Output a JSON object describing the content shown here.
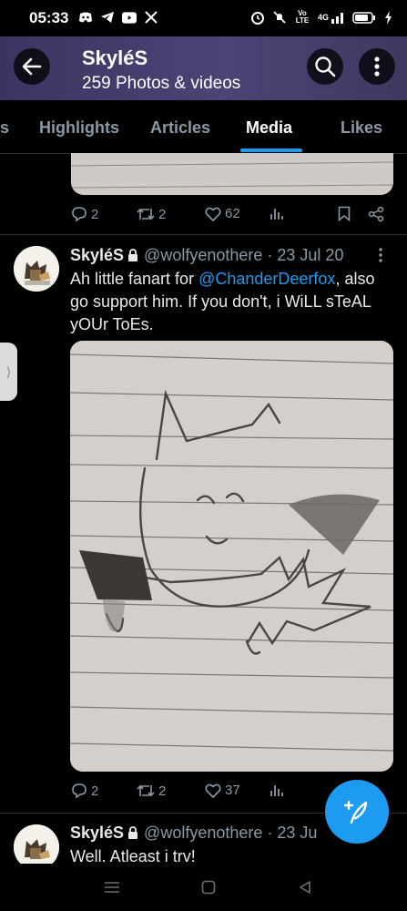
{
  "status_bar": {
    "time": "05:33",
    "left_icons": [
      "discord-icon",
      "telegram-icon",
      "youtube-icon",
      "x-icon"
    ],
    "right_icons": [
      "alarm-icon",
      "mute-icon",
      "volte-icon",
      "signal-icon",
      "battery-icon",
      "charging-icon"
    ],
    "volte_text": "Vo LTE",
    "signal_text": "4G"
  },
  "header": {
    "title": "SkyléS",
    "subtitle": "259 Photos & videos",
    "gradient": "#3a3560"
  },
  "tabs": [
    {
      "label": "s"
    },
    {
      "label": "Highlights"
    },
    {
      "label": "Articles"
    },
    {
      "label": "Media"
    },
    {
      "label": "Likes"
    }
  ],
  "active_tab": "Media",
  "accent_color": "#1d9bf0",
  "previous_post": {
    "replies": "2",
    "reposts": "2",
    "likes": "62"
  },
  "tweets": [
    {
      "name": "SkyléS",
      "handle": "@wolfyenothere",
      "date": "· 23 Jul 20",
      "text_before": "Ah little fanart for ",
      "mention": "@ChanderDeerfox",
      "text_after": ", also go support him. If you don't, i WiLL sTeAL yOUr ToEs.",
      "replies": "2",
      "reposts": "2",
      "likes": "37"
    },
    {
      "name": "SkyléS",
      "handle": "@wolfyenothere",
      "date": "· 23 Ju",
      "text": "Well. Atleast i trv!"
    }
  ],
  "icons": {
    "back": "back-arrow-icon",
    "search": "search-icon",
    "more": "more-vertical-icon",
    "compose": "compose-feather-icon"
  }
}
